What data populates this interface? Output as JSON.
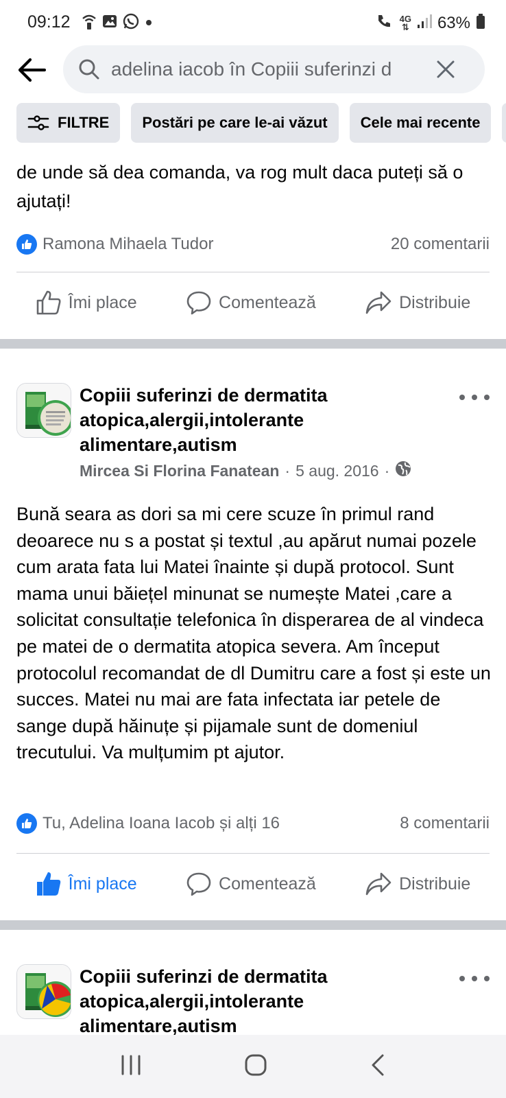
{
  "status_bar": {
    "time": "09:12",
    "battery": "63%",
    "network": "4G"
  },
  "search": {
    "query": "adelina iacob în Copiii suferinzi d"
  },
  "filters": [
    {
      "label": "FILTRE"
    },
    {
      "label": "Postări pe care le-ai văzut"
    },
    {
      "label": "Cele mai recente"
    }
  ],
  "post1": {
    "text": "de unde să dea comanda, va rog mult daca puteți să o ajutați!",
    "reactions": "Ramona Mihaela Tudor",
    "comments": "20 comentarii",
    "actions": {
      "like": "Îmi place",
      "comment": "Comentează",
      "share": "Distribuie"
    }
  },
  "post2": {
    "group": "Copiii suferinzi de dermatita atopica,alergii,intolerante alimentare,autism",
    "author": "Mircea Si Florina Fanatean",
    "date": "5 aug. 2016",
    "dot": "·",
    "text": "Bună seara as dori sa mi cere scuze în primul rand deoarece nu s a postat și textul  ,au apărut numai pozele cum arata fata lui Matei înainte și după protocol. Sunt mama unui băiețel minunat se numește Matei  ,care a solicitat consultație telefonica în disperarea de al vindeca pe matei de o dermatita atopica severa. Am început protocolul recomandat de dl Dumitru care a fost și este un succes. Matei nu mai are fata infectata iar petele de sange după hăinuțe și pijamale sunt de domeniul trecutului. Va mulțumim pt ajutor.",
    "reactions": "Tu, Adelina Ioana Iacob și alți 16",
    "comments": "8 comentarii",
    "actions": {
      "like": "Îmi place",
      "comment": "Comentează",
      "share": "Distribuie"
    }
  },
  "post3": {
    "group": "Copiii suferinzi de dermatita atopica,alergii,intolerante alimentare,autism"
  },
  "colors": {
    "accent": "#1877f2",
    "secondary_text": "#65676b",
    "chip_bg": "#e4e6eb",
    "separator": "#c9ccd1"
  }
}
